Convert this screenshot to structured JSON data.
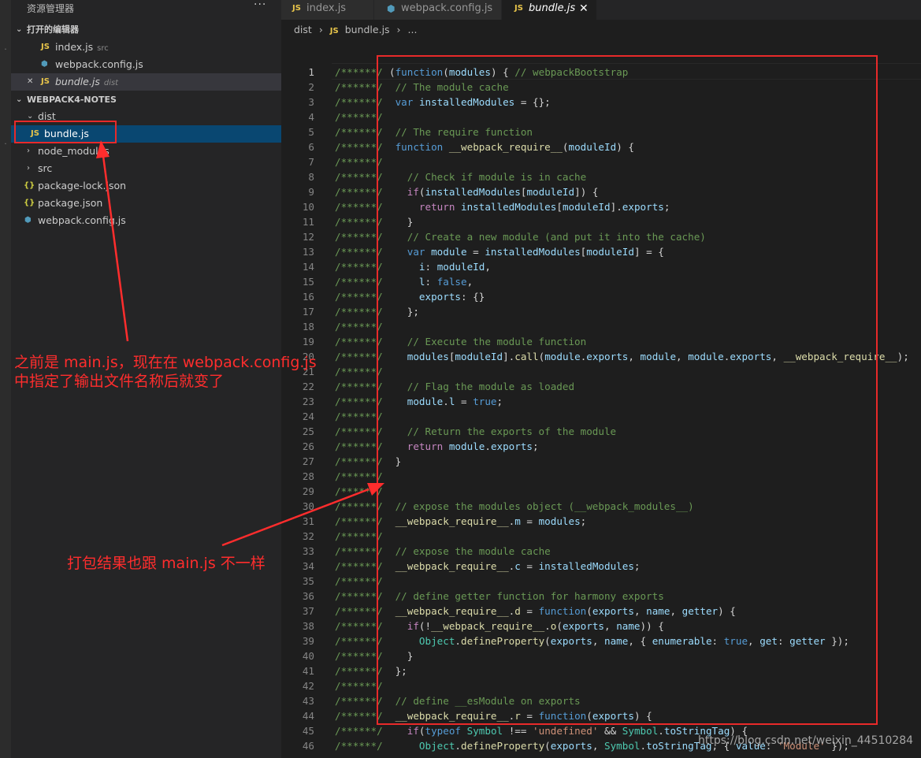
{
  "explorer": {
    "title": "资源管理器",
    "more": "···",
    "open_editors_title": "打开的编辑器",
    "open_editors": [
      {
        "icon": "JS",
        "name": "index.js",
        "hint": "src"
      },
      {
        "icon": "⬢",
        "name": "webpack.config.js",
        "hint": ""
      },
      {
        "icon": "JS",
        "name": "bundle.js",
        "hint": "dist",
        "close": "✕"
      }
    ],
    "project_title": "WEBPACK4-NOTES",
    "tree": [
      {
        "arrow": "⌄",
        "icon": "",
        "name": "dist"
      },
      {
        "arrow": "",
        "icon": "JS",
        "name": "bundle.js"
      },
      {
        "arrow": "›",
        "icon": "",
        "name": "node_modules"
      },
      {
        "arrow": "›",
        "icon": "",
        "name": "src"
      },
      {
        "arrow": "",
        "icon": "{}",
        "name": "package-lock.json"
      },
      {
        "arrow": "",
        "icon": "{}",
        "name": "package.json"
      },
      {
        "arrow": "",
        "icon": "⬢",
        "name": "webpack.config.js"
      }
    ]
  },
  "tabs": [
    {
      "icon": "JS",
      "label": "index.js"
    },
    {
      "icon": "⬢",
      "label": "webpack.config.js"
    },
    {
      "icon": "JS",
      "label": "bundle.js",
      "close": "✕"
    }
  ],
  "breadcrumb": {
    "folder": "dist",
    "sep": "›",
    "icon": "JS",
    "file": "bundle.js",
    "sep2": "›",
    "rest": "..."
  },
  "editor": {
    "current_line": 1,
    "gutter_text": "/******/",
    "lines": [
      [
        [
          "p",
          "("
        ],
        [
          "k",
          "function"
        ],
        [
          "p",
          "("
        ],
        [
          "v",
          "modules"
        ],
        [
          "p",
          ") { "
        ],
        [
          "c",
          "// webpackBootstrap"
        ]
      ],
      [
        [
          "p",
          " "
        ],
        [
          "c",
          "// The module cache"
        ]
      ],
      [
        [
          "p",
          " "
        ],
        [
          "k",
          "var"
        ],
        [
          "p",
          " "
        ],
        [
          "v",
          "installedModules"
        ],
        [
          "p",
          " = {};"
        ]
      ],
      [],
      [
        [
          "p",
          " "
        ],
        [
          "c",
          "// The require function"
        ]
      ],
      [
        [
          "p",
          " "
        ],
        [
          "k",
          "function"
        ],
        [
          "p",
          " "
        ],
        [
          "f",
          "__webpack_require__"
        ],
        [
          "p",
          "("
        ],
        [
          "v",
          "moduleId"
        ],
        [
          "p",
          ") {"
        ]
      ],
      [],
      [
        [
          "p",
          "   "
        ],
        [
          "c",
          "// Check if module is in cache"
        ]
      ],
      [
        [
          "p",
          "   "
        ],
        [
          "b",
          "if"
        ],
        [
          "p",
          "("
        ],
        [
          "v",
          "installedModules"
        ],
        [
          "p",
          "["
        ],
        [
          "v",
          "moduleId"
        ],
        [
          "p",
          "]) {"
        ]
      ],
      [
        [
          "p",
          "     "
        ],
        [
          "b",
          "return"
        ],
        [
          "p",
          " "
        ],
        [
          "v",
          "installedModules"
        ],
        [
          "p",
          "["
        ],
        [
          "v",
          "moduleId"
        ],
        [
          "p",
          "]."
        ],
        [
          "v",
          "exports"
        ],
        [
          "p",
          ";"
        ]
      ],
      [
        [
          "p",
          "   }"
        ]
      ],
      [
        [
          "p",
          "   "
        ],
        [
          "c",
          "// Create a new module (and put it into the cache)"
        ]
      ],
      [
        [
          "p",
          "   "
        ],
        [
          "k",
          "var"
        ],
        [
          "p",
          " "
        ],
        [
          "v",
          "module"
        ],
        [
          "p",
          " = "
        ],
        [
          "v",
          "installedModules"
        ],
        [
          "p",
          "["
        ],
        [
          "v",
          "moduleId"
        ],
        [
          "p",
          "] = {"
        ]
      ],
      [
        [
          "p",
          "     "
        ],
        [
          "v",
          "i"
        ],
        [
          "p",
          ": "
        ],
        [
          "v",
          "moduleId"
        ],
        [
          "p",
          ","
        ]
      ],
      [
        [
          "p",
          "     "
        ],
        [
          "v",
          "l"
        ],
        [
          "p",
          ": "
        ],
        [
          "k",
          "false"
        ],
        [
          "p",
          ","
        ]
      ],
      [
        [
          "p",
          "     "
        ],
        [
          "v",
          "exports"
        ],
        [
          "p",
          ": {}"
        ]
      ],
      [
        [
          "p",
          "   };"
        ]
      ],
      [],
      [
        [
          "p",
          "   "
        ],
        [
          "c",
          "// Execute the module function"
        ]
      ],
      [
        [
          "p",
          "   "
        ],
        [
          "v",
          "modules"
        ],
        [
          "p",
          "["
        ],
        [
          "v",
          "moduleId"
        ],
        [
          "p",
          "]."
        ],
        [
          "f",
          "call"
        ],
        [
          "p",
          "("
        ],
        [
          "v",
          "module"
        ],
        [
          "p",
          "."
        ],
        [
          "v",
          "exports"
        ],
        [
          "p",
          ", "
        ],
        [
          "v",
          "module"
        ],
        [
          "p",
          ", "
        ],
        [
          "v",
          "module"
        ],
        [
          "p",
          "."
        ],
        [
          "v",
          "exports"
        ],
        [
          "p",
          ", "
        ],
        [
          "f",
          "__webpack_require__"
        ],
        [
          "p",
          ");"
        ]
      ],
      [],
      [
        [
          "p",
          "   "
        ],
        [
          "c",
          "// Flag the module as loaded"
        ]
      ],
      [
        [
          "p",
          "   "
        ],
        [
          "v",
          "module"
        ],
        [
          "p",
          "."
        ],
        [
          "v",
          "l"
        ],
        [
          "p",
          " = "
        ],
        [
          "k",
          "true"
        ],
        [
          "p",
          ";"
        ]
      ],
      [],
      [
        [
          "p",
          "   "
        ],
        [
          "c",
          "// Return the exports of the module"
        ]
      ],
      [
        [
          "p",
          "   "
        ],
        [
          "b",
          "return"
        ],
        [
          "p",
          " "
        ],
        [
          "v",
          "module"
        ],
        [
          "p",
          "."
        ],
        [
          "v",
          "exports"
        ],
        [
          "p",
          ";"
        ]
      ],
      [
        [
          "p",
          " }"
        ]
      ],
      [],
      [],
      [
        [
          "p",
          " "
        ],
        [
          "c",
          "// expose the modules object (__webpack_modules__)"
        ]
      ],
      [
        [
          "p",
          " "
        ],
        [
          "f",
          "__webpack_require__"
        ],
        [
          "p",
          "."
        ],
        [
          "v",
          "m"
        ],
        [
          "p",
          " = "
        ],
        [
          "v",
          "modules"
        ],
        [
          "p",
          ";"
        ]
      ],
      [],
      [
        [
          "p",
          " "
        ],
        [
          "c",
          "// expose the module cache"
        ]
      ],
      [
        [
          "p",
          " "
        ],
        [
          "f",
          "__webpack_require__"
        ],
        [
          "p",
          "."
        ],
        [
          "v",
          "c"
        ],
        [
          "p",
          " = "
        ],
        [
          "v",
          "installedModules"
        ],
        [
          "p",
          ";"
        ]
      ],
      [],
      [
        [
          "p",
          " "
        ],
        [
          "c",
          "// define getter function for harmony exports"
        ]
      ],
      [
        [
          "p",
          " "
        ],
        [
          "f",
          "__webpack_require__"
        ],
        [
          "p",
          "."
        ],
        [
          "f",
          "d"
        ],
        [
          "p",
          " = "
        ],
        [
          "k",
          "function"
        ],
        [
          "p",
          "("
        ],
        [
          "v",
          "exports"
        ],
        [
          "p",
          ", "
        ],
        [
          "v",
          "name"
        ],
        [
          "p",
          ", "
        ],
        [
          "v",
          "getter"
        ],
        [
          "p",
          ") {"
        ]
      ],
      [
        [
          "p",
          "   "
        ],
        [
          "b",
          "if"
        ],
        [
          "p",
          "(!"
        ],
        [
          "f",
          "__webpack_require__"
        ],
        [
          "p",
          "."
        ],
        [
          "f",
          "o"
        ],
        [
          "p",
          "("
        ],
        [
          "v",
          "exports"
        ],
        [
          "p",
          ", "
        ],
        [
          "v",
          "name"
        ],
        [
          "p",
          ")) {"
        ]
      ],
      [
        [
          "p",
          "     "
        ],
        [
          "t",
          "Object"
        ],
        [
          "p",
          "."
        ],
        [
          "f",
          "defineProperty"
        ],
        [
          "p",
          "("
        ],
        [
          "v",
          "exports"
        ],
        [
          "p",
          ", "
        ],
        [
          "v",
          "name"
        ],
        [
          "p",
          ", { "
        ],
        [
          "v",
          "enumerable"
        ],
        [
          "p",
          ": "
        ],
        [
          "k",
          "true"
        ],
        [
          "p",
          ", "
        ],
        [
          "v",
          "get"
        ],
        [
          "p",
          ": "
        ],
        [
          "v",
          "getter"
        ],
        [
          "p",
          " });"
        ]
      ],
      [
        [
          "p",
          "   }"
        ]
      ],
      [
        [
          "p",
          " };"
        ]
      ],
      [],
      [
        [
          "p",
          " "
        ],
        [
          "c",
          "// define __esModule on exports"
        ]
      ],
      [
        [
          "p",
          " "
        ],
        [
          "f",
          "__webpack_require__"
        ],
        [
          "p",
          "."
        ],
        [
          "f",
          "r"
        ],
        [
          "p",
          " = "
        ],
        [
          "k",
          "function"
        ],
        [
          "p",
          "("
        ],
        [
          "v",
          "exports"
        ],
        [
          "p",
          ") {"
        ]
      ],
      [
        [
          "p",
          "   "
        ],
        [
          "b",
          "if"
        ],
        [
          "p",
          "("
        ],
        [
          "k",
          "typeof"
        ],
        [
          "p",
          " "
        ],
        [
          "t",
          "Symbol"
        ],
        [
          "p",
          " !== "
        ],
        [
          "s",
          "'undefined'"
        ],
        [
          "p",
          " && "
        ],
        [
          "t",
          "Symbol"
        ],
        [
          "p",
          "."
        ],
        [
          "v",
          "toStringTag"
        ],
        [
          "p",
          ") {"
        ]
      ],
      [
        [
          "p",
          "     "
        ],
        [
          "t",
          "Object"
        ],
        [
          "p",
          "."
        ],
        [
          "f",
          "defineProperty"
        ],
        [
          "p",
          "("
        ],
        [
          "v",
          "exports"
        ],
        [
          "p",
          ", "
        ],
        [
          "t",
          "Symbol"
        ],
        [
          "p",
          "."
        ],
        [
          "v",
          "toStringTag"
        ],
        [
          "p",
          ", { "
        ],
        [
          "v",
          "value"
        ],
        [
          "p",
          ": "
        ],
        [
          "s",
          "'Module'"
        ],
        [
          "p",
          " });"
        ]
      ]
    ]
  },
  "annotations": {
    "note1_line1": "之前是 main.js，现在在 webpack.config.js",
    "note1_line2": "中指定了输出文件名称后就变了",
    "note2": "打包结果也跟 main.js 不一样",
    "color": "#ff2d2d"
  },
  "watermark": "https://blog.csdn.net/weixin_44510284"
}
